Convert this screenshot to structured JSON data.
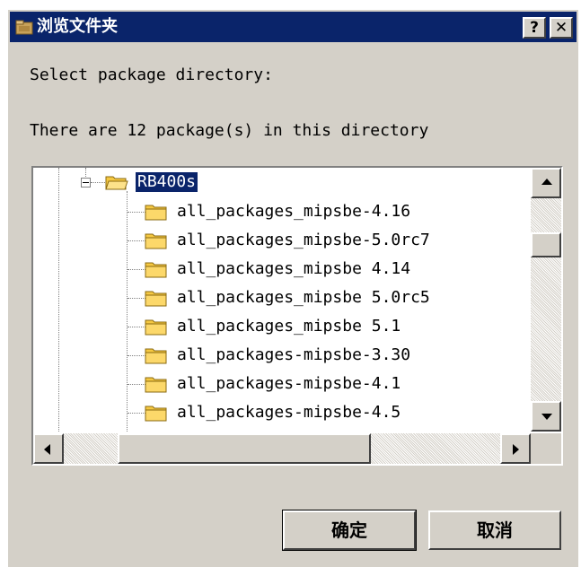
{
  "window": {
    "title": "浏览文件夹",
    "title_icon": "folder-box-icon",
    "help_label": "?",
    "close_label": "✕"
  },
  "prompt": {
    "line1": "Select package directory:",
    "line2": "There are 12 package(s) in this directory"
  },
  "tree": {
    "root_node": {
      "label": "RB400s",
      "expanded": true,
      "selected": true
    },
    "children": [
      "all_packages_mipsbe-4.16",
      "all_packages_mipsbe-5.0rc7",
      "all_packages_mipsbe 4.14",
      "all_packages_mipsbe 5.0rc5",
      "all_packages_mipsbe 5.1",
      "all_packages-mipsbe-3.30",
      "all_packages-mipsbe-4.1",
      "all_packages-mipsbe-4.5"
    ]
  },
  "buttons": {
    "ok": "确定",
    "cancel": "取消"
  },
  "colors": {
    "titlebar": "#0a246a",
    "face": "#d4d0c8",
    "folder": "#f5c842",
    "selection": "#0a246a"
  }
}
